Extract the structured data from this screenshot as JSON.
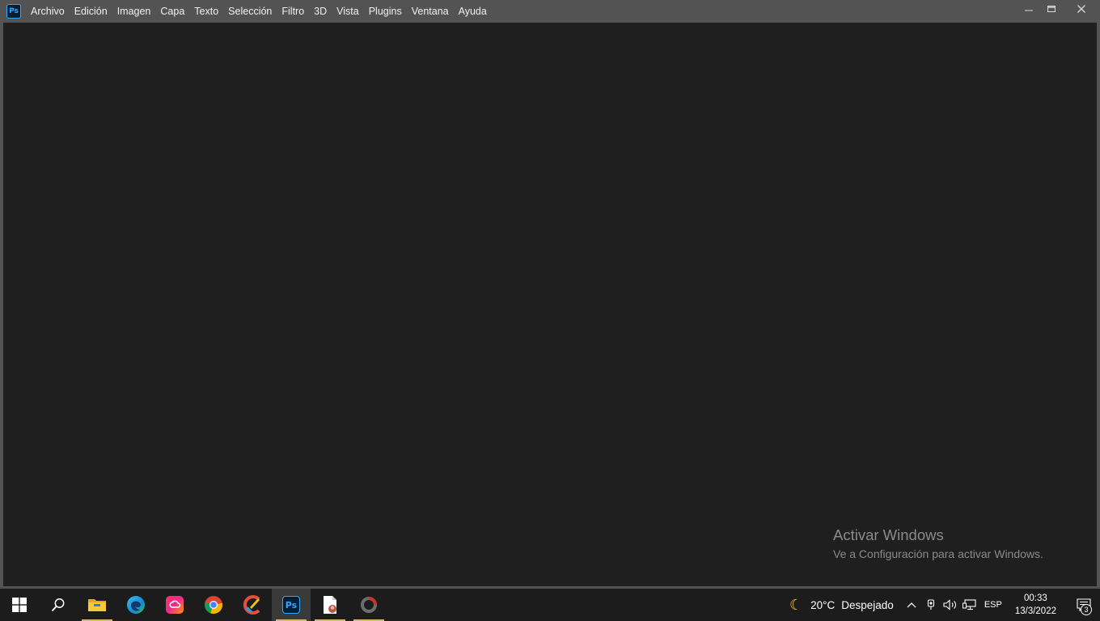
{
  "app": {
    "logo_text": "Ps"
  },
  "menu": {
    "items": [
      {
        "id": "archivo",
        "label": "Archivo"
      },
      {
        "id": "edicion",
        "label": "Edición"
      },
      {
        "id": "imagen",
        "label": "Imagen"
      },
      {
        "id": "capa",
        "label": "Capa"
      },
      {
        "id": "texto",
        "label": "Texto"
      },
      {
        "id": "seleccion",
        "label": "Selección"
      },
      {
        "id": "filtro",
        "label": "Filtro"
      },
      {
        "id": "3d",
        "label": "3D"
      },
      {
        "id": "vista",
        "label": "Vista"
      },
      {
        "id": "plugins",
        "label": "Plugins"
      },
      {
        "id": "ventana",
        "label": "Ventana"
      },
      {
        "id": "ayuda",
        "label": "Ayuda"
      }
    ]
  },
  "window_controls": [
    "minimize-icon",
    "maximize-icon",
    "close-icon"
  ],
  "watermark": {
    "title": "Activar Windows",
    "subtitle": "Ve a Configuración para activar Windows."
  },
  "taskbar": {
    "apps": [
      {
        "id": "start",
        "icon": "windows-start-icon"
      },
      {
        "id": "search",
        "icon": "search-icon"
      },
      {
        "id": "explorer",
        "icon": "file-explorer-icon",
        "running": true
      },
      {
        "id": "edge",
        "icon": "edge-icon"
      },
      {
        "id": "creative-cloud",
        "icon": "creative-cloud-icon"
      },
      {
        "id": "chrome",
        "icon": "chrome-icon"
      },
      {
        "id": "ccleaner",
        "icon": "ccleaner-icon"
      },
      {
        "id": "photoshop",
        "icon": "photoshop-icon",
        "running": true,
        "active": true,
        "label": "Ps"
      },
      {
        "id": "document",
        "icon": "document-icon",
        "running": true
      },
      {
        "id": "recorder",
        "icon": "recorder-icon",
        "running": true
      }
    ],
    "tray": {
      "weather": {
        "icon": "moon-icon",
        "temperature": "20°C",
        "condition": "Despejado"
      },
      "icons": [
        "chevron-up-icon",
        "meet-icon",
        "volume-icon",
        "network-icon"
      ],
      "language": "ESP",
      "time": "00:33",
      "date": "13/3/2022",
      "notification_count": "3"
    }
  },
  "colors": {
    "chrome_bg": "#535353",
    "workspace_bg": "#1f1f1f",
    "taskbar_bg": "#1c1c1c",
    "running_indicator": "#dcb46e",
    "ps_blue": "#31a8ff"
  }
}
